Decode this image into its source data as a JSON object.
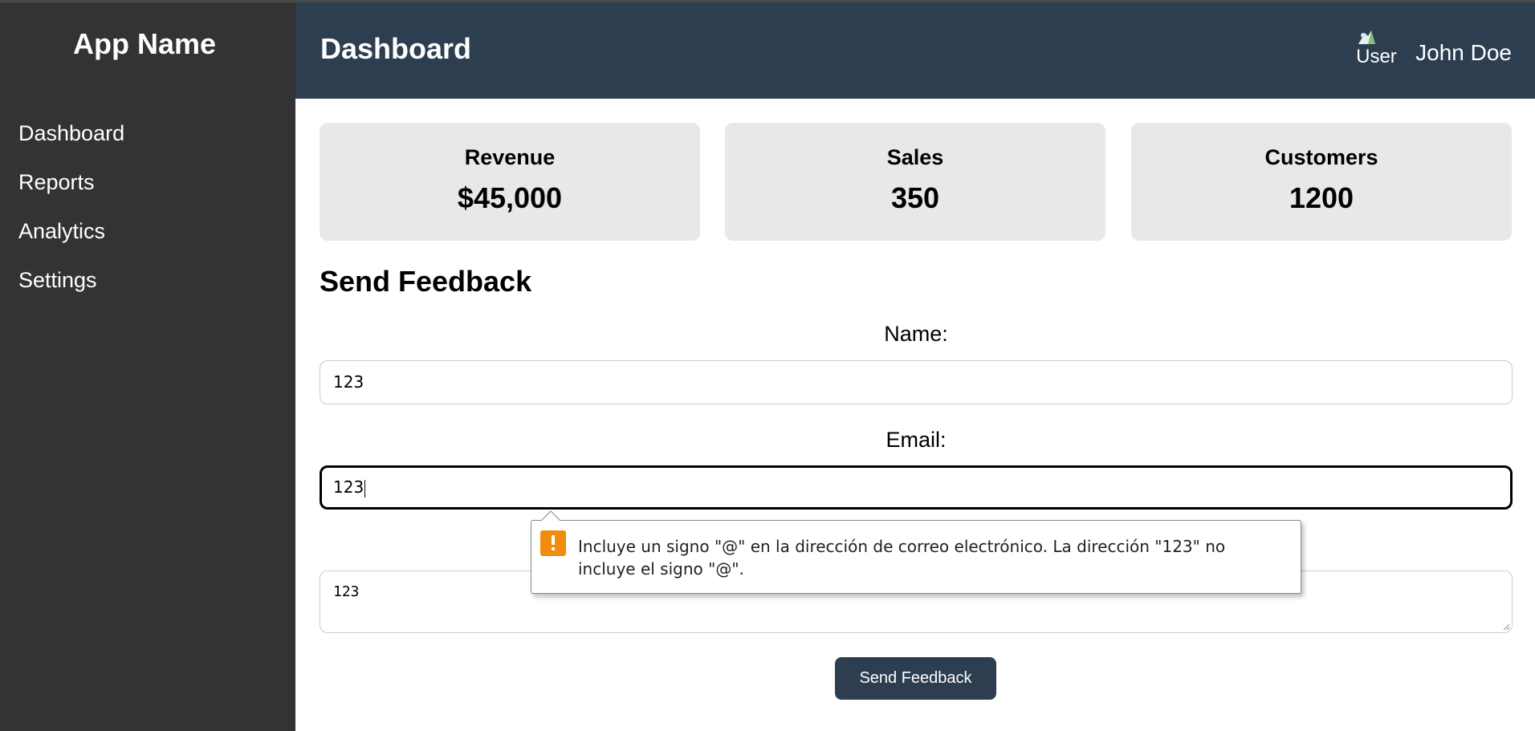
{
  "sidebar": {
    "app_name": "App Name",
    "items": [
      {
        "label": "Dashboard"
      },
      {
        "label": "Reports"
      },
      {
        "label": "Analytics"
      },
      {
        "label": "Settings"
      }
    ]
  },
  "header": {
    "title": "Dashboard",
    "avatar_alt": "User",
    "user_name": "John Doe"
  },
  "cards": [
    {
      "label": "Revenue",
      "value": "$45,000"
    },
    {
      "label": "Sales",
      "value": "350"
    },
    {
      "label": "Customers",
      "value": "1200"
    }
  ],
  "feedback": {
    "title": "Send Feedback",
    "name_label": "Name:",
    "name_value": "123",
    "email_label": "Email:",
    "email_value": "123",
    "message_value": "123",
    "submit_label": "Send Feedback"
  },
  "validation": {
    "message": "Incluye un signo \"@\" en la dirección de correo electrónico. La dirección \"123\" no incluye el signo \"@\"."
  },
  "colors": {
    "sidebar_bg": "#333333",
    "header_bg": "#2d3e50",
    "card_bg": "#e8e8e8",
    "button_bg": "#2d3e50",
    "warning": "#f28c0f"
  }
}
